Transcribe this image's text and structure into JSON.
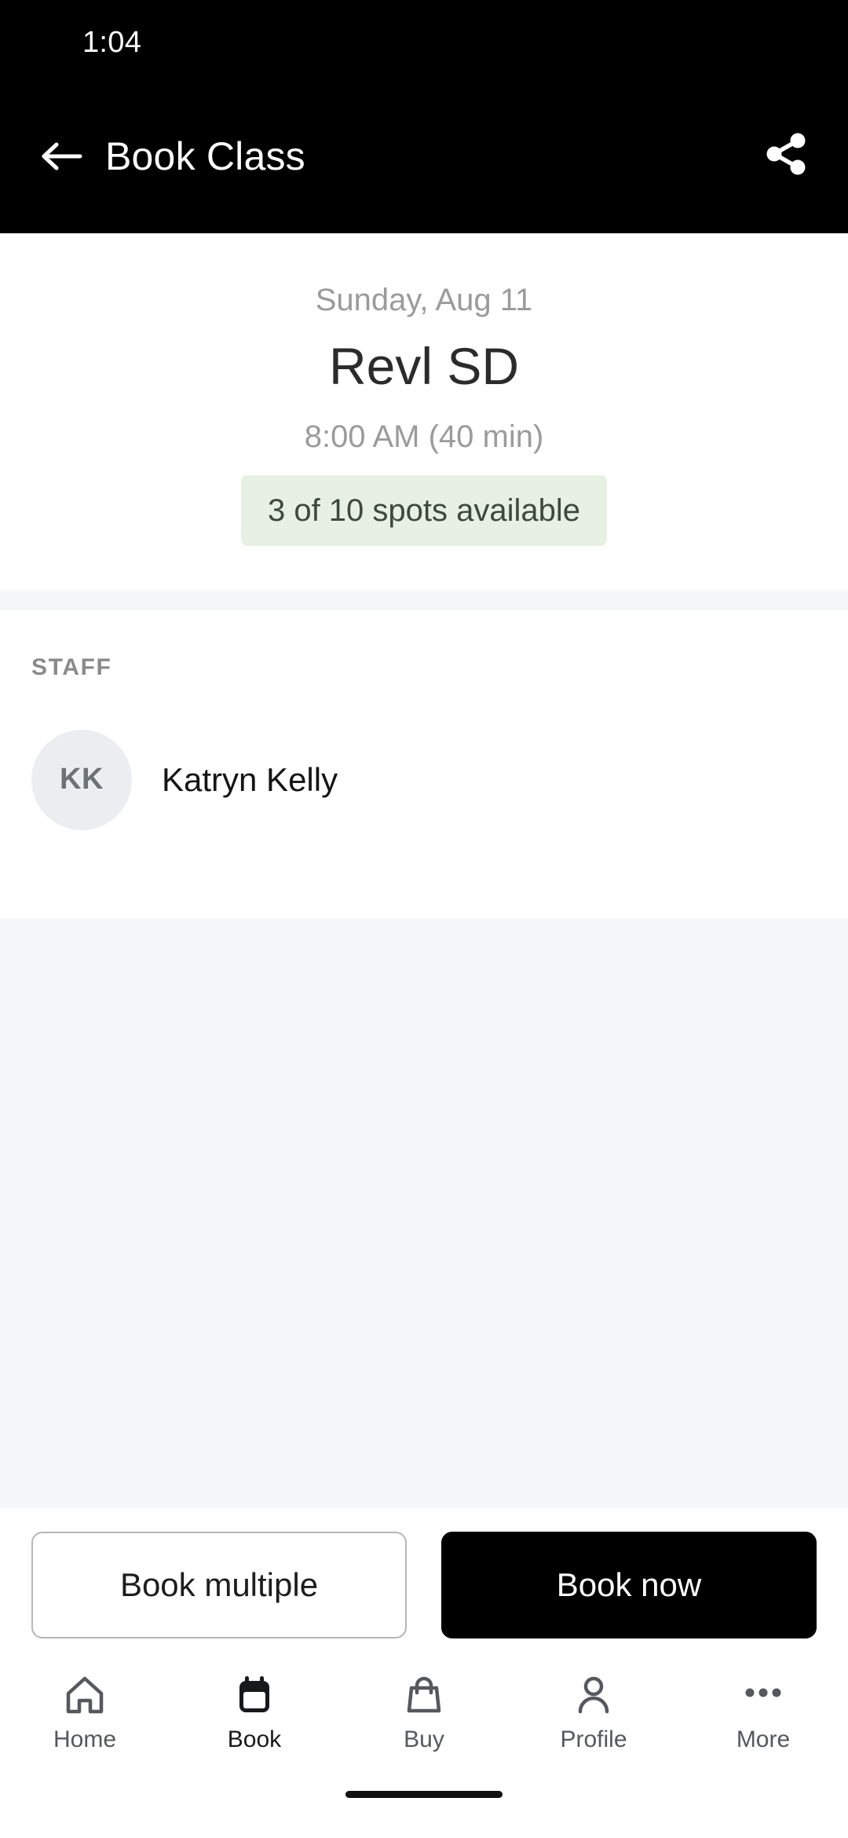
{
  "status_bar": {
    "time": "1:04"
  },
  "app_bar": {
    "title": "Book Class",
    "back_icon": "arrow-left-icon",
    "share_icon": "share-icon"
  },
  "class_header": {
    "date": "Sunday, Aug 11",
    "name": "Revl SD",
    "time": "8:00 AM (40 min)",
    "spots": "3 of 10 spots available",
    "spots_badge_bg": "#e7f0e3",
    "spots_badge_text_color": "#3d4a3b"
  },
  "staff": {
    "section_label": "STAFF",
    "members": [
      {
        "initials": "KK",
        "name": "Katryn Kelly"
      }
    ]
  },
  "actions": {
    "secondary_label": "Book multiple",
    "primary_label": "Book now",
    "primary_bg": "#000000"
  },
  "bottom_nav": {
    "items": [
      {
        "label": "Home",
        "icon": "home-icon",
        "active": false
      },
      {
        "label": "Book",
        "icon": "calendar-icon",
        "active": true
      },
      {
        "label": "Buy",
        "icon": "shopping-bag-icon",
        "active": false
      },
      {
        "label": "Profile",
        "icon": "person-icon",
        "active": false
      },
      {
        "label": "More",
        "icon": "ellipsis-icon",
        "active": false
      }
    ]
  }
}
